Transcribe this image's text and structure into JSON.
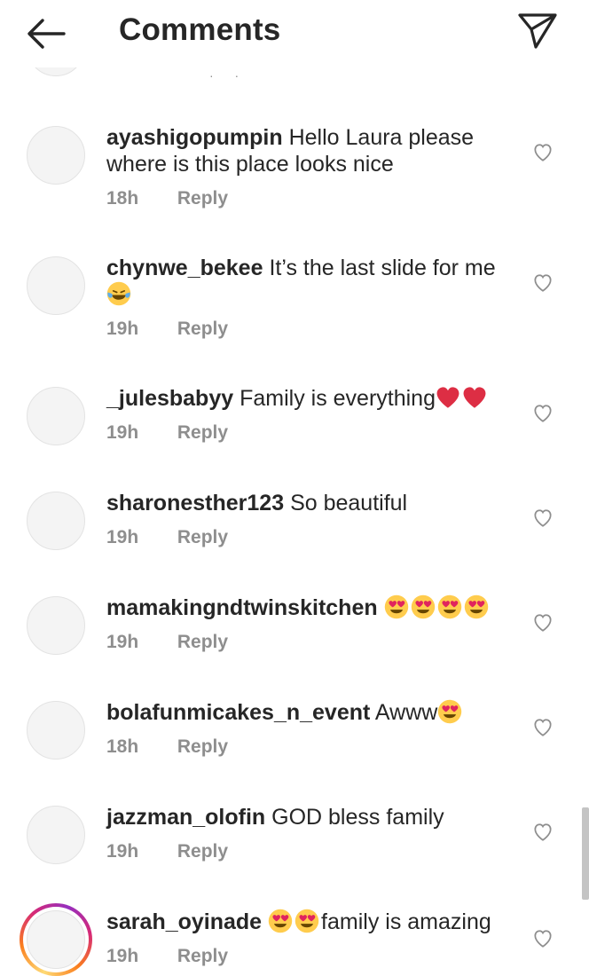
{
  "header": {
    "title": "Comments",
    "back_icon": "arrow-left-icon",
    "send_icon": "paper-plane-icon"
  },
  "reply_label": "Reply",
  "emoji_names": {
    "heart_eyes": "smiling-face-with-heart-eyes",
    "tears_of_joy": "face-with-tears-of-joy",
    "heart": "red-heart"
  },
  "comments": [
    {
      "username": "ayashigopumpin",
      "text": "Hello Laura please where is this place looks nice",
      "time": "18h"
    },
    {
      "username": "chynwe_bekee",
      "text": "It’s the last slide for me",
      "time": "19h"
    },
    {
      "username": "_julesbabyy",
      "text": "Family is everything",
      "time": "19h"
    },
    {
      "username": "sharonesther123",
      "text": "So beautiful",
      "time": "19h"
    },
    {
      "username": "mamakingndtwinskitchen",
      "text": "",
      "time": "19h"
    },
    {
      "username": "bolafunmicakes_n_event",
      "text": "Awww",
      "time": "18h"
    },
    {
      "username": "jazzman_olofin",
      "text": "GOD bless family",
      "time": "19h"
    },
    {
      "username": "sarah_oyinade",
      "text": "family is amazing",
      "time": "19h",
      "has_story": true
    }
  ],
  "colors": {
    "text": "#262626",
    "secondary": "#8e8e8e",
    "heart": "#ed4956",
    "emoji_yellow": "#ffcc4d"
  }
}
